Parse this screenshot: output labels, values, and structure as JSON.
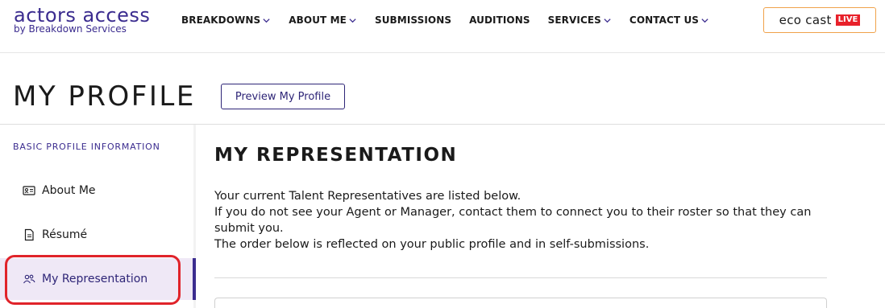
{
  "header": {
    "logo_main": "actors access",
    "logo_sub": "by Breakdown Services",
    "nav": [
      {
        "label": "BREAKDOWNS",
        "dropdown": true
      },
      {
        "label": "ABOUT ME",
        "dropdown": true
      },
      {
        "label": "SUBMISSIONS",
        "dropdown": false
      },
      {
        "label": "AUDITIONS",
        "dropdown": false
      },
      {
        "label": "SERVICES",
        "dropdown": true
      },
      {
        "label": "CONTACT US",
        "dropdown": true
      }
    ],
    "ecocast_label": "eco cast",
    "ecocast_badge": "LIVE"
  },
  "page": {
    "title": "MY PROFILE",
    "preview_button": "Preview My Profile"
  },
  "sidebar": {
    "heading": "BASIC PROFILE INFORMATION",
    "items": [
      {
        "label": "About Me",
        "icon": "id-card-icon"
      },
      {
        "label": "Résumé",
        "icon": "document-icon"
      },
      {
        "label": "My Representation",
        "icon": "people-icon",
        "active": true
      }
    ]
  },
  "main": {
    "section_title": "MY REPRESENTATION",
    "lines": [
      "Your current Talent Representatives are listed below.",
      "If you do not see your Agent or Manager, contact them to connect you to their roster so that they can submit you.",
      "The order below is reflected on your public profile and in self-submissions."
    ]
  },
  "colors": {
    "brand_purple": "#3b2c8f",
    "active_bg": "#efe8f6",
    "ecocast_border": "#f0a24a",
    "live_red": "#e8212a",
    "highlight_red": "#e0232a"
  }
}
